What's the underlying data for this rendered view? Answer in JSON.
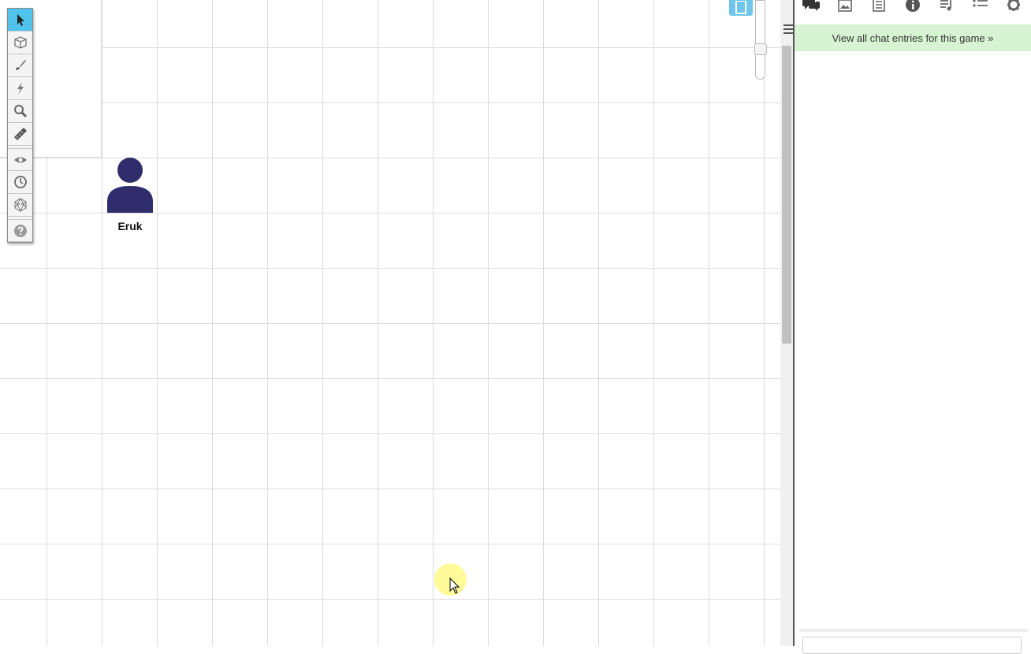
{
  "toolbar": {
    "tools": [
      {
        "name": "select-tool",
        "icon": "pointer-icon",
        "active": true
      },
      {
        "name": "layer-tool",
        "icon": "cube-icon"
      },
      {
        "name": "draw-tool",
        "icon": "brush-icon"
      },
      {
        "name": "fx-tool",
        "icon": "lightning-icon"
      },
      {
        "name": "zoom-tool",
        "icon": "magnifier-icon"
      },
      {
        "name": "measure-tool",
        "icon": "ruler-icon"
      },
      {
        "name": "fog-tool",
        "icon": "eye-icon"
      },
      {
        "name": "turn-tracker-tool",
        "icon": "clock-icon"
      },
      {
        "name": "dice-tool",
        "icon": "d20-icon"
      },
      {
        "name": "help-tool",
        "icon": "question-icon"
      }
    ],
    "active_color": "#4fc3ec"
  },
  "token": {
    "label": "Eruk",
    "color": "#2f2d6b"
  },
  "sidebar": {
    "tabs": [
      "chat-icon",
      "art-library-icon",
      "journal-icon",
      "info-icon",
      "jukebox-icon",
      "list-icon",
      "settings-icon"
    ],
    "chat_banner": "View all chat entries for this game »",
    "banner_color": "#d6f4d1"
  }
}
